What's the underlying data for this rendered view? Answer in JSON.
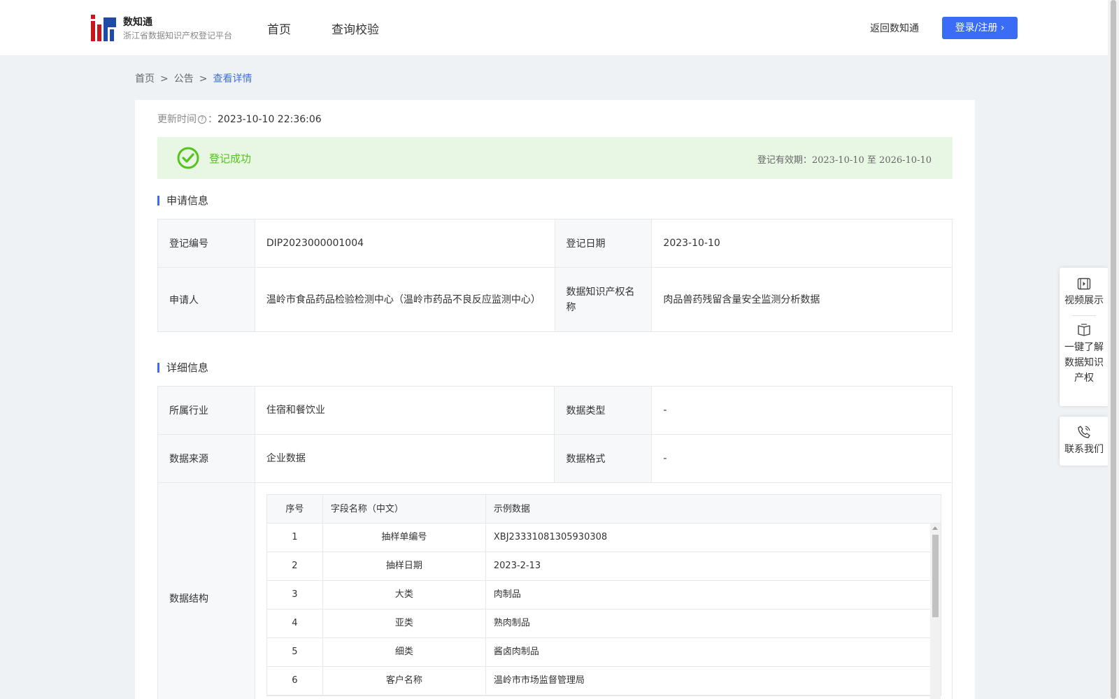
{
  "header": {
    "logo_title": "数知通",
    "logo_subtitle": "浙江省数据知识产权登记平台",
    "nav": [
      "首页",
      "查询校验"
    ],
    "return_link": "返回数知通",
    "login_button": "登录/注册 ›"
  },
  "breadcrumb": {
    "items": [
      "首页",
      "公告",
      "查看详情"
    ],
    "separator": ">"
  },
  "update": {
    "label": "更新时间",
    "help": "?",
    "colon": "：",
    "value": "2023-10-10 22:36:06"
  },
  "status": {
    "text": "登记成功",
    "validity_label": "登记有效期：",
    "start": "2023-10-10",
    "to": " 至 ",
    "end": "2026-10-10",
    "color": "#52c41a"
  },
  "application": {
    "title": "申请信息",
    "rows": [
      {
        "l1": "登记编号",
        "v1": "DIP2023000001004",
        "l2": "登记日期",
        "v2": "2023-10-10"
      },
      {
        "l1": "申请人",
        "v1": "温岭市食品药品检验检测中心（温岭市药品不良反应监测中心）",
        "l2": "数据知识产权名称",
        "v2": "肉品兽药残留含量安全监测分析数据"
      }
    ]
  },
  "details": {
    "title": "详细信息",
    "rows": [
      {
        "l1": "所属行业",
        "v1": "住宿和餐饮业",
        "l2": "数据类型",
        "v2": "-"
      },
      {
        "l1": "数据来源",
        "v1": "企业数据",
        "l2": "数据格式",
        "v2": "-"
      }
    ],
    "structure_label": "数据结构",
    "structure": {
      "headers": [
        "序号",
        "字段名称（中文）",
        "示例数据"
      ],
      "rows": [
        [
          "1",
          "抽样单编号",
          "XBJ23331081305930308"
        ],
        [
          "2",
          "抽样日期",
          "2023-2-13"
        ],
        [
          "3",
          "大类",
          "肉制品"
        ],
        [
          "4",
          "亚类",
          "熟肉制品"
        ],
        [
          "5",
          "细类",
          "酱卤肉制品"
        ],
        [
          "6",
          "客户名称",
          "温岭市市场监督管理局"
        ]
      ]
    }
  },
  "side_panel": {
    "video": "视频展示",
    "learn": [
      "一键了解",
      "数据知识",
      "产权"
    ],
    "contact": "联系我们"
  },
  "colors": {
    "accent": "#3b6cf6",
    "success_bg": "#e8f7e4",
    "page_bg": "#eff2f5"
  }
}
